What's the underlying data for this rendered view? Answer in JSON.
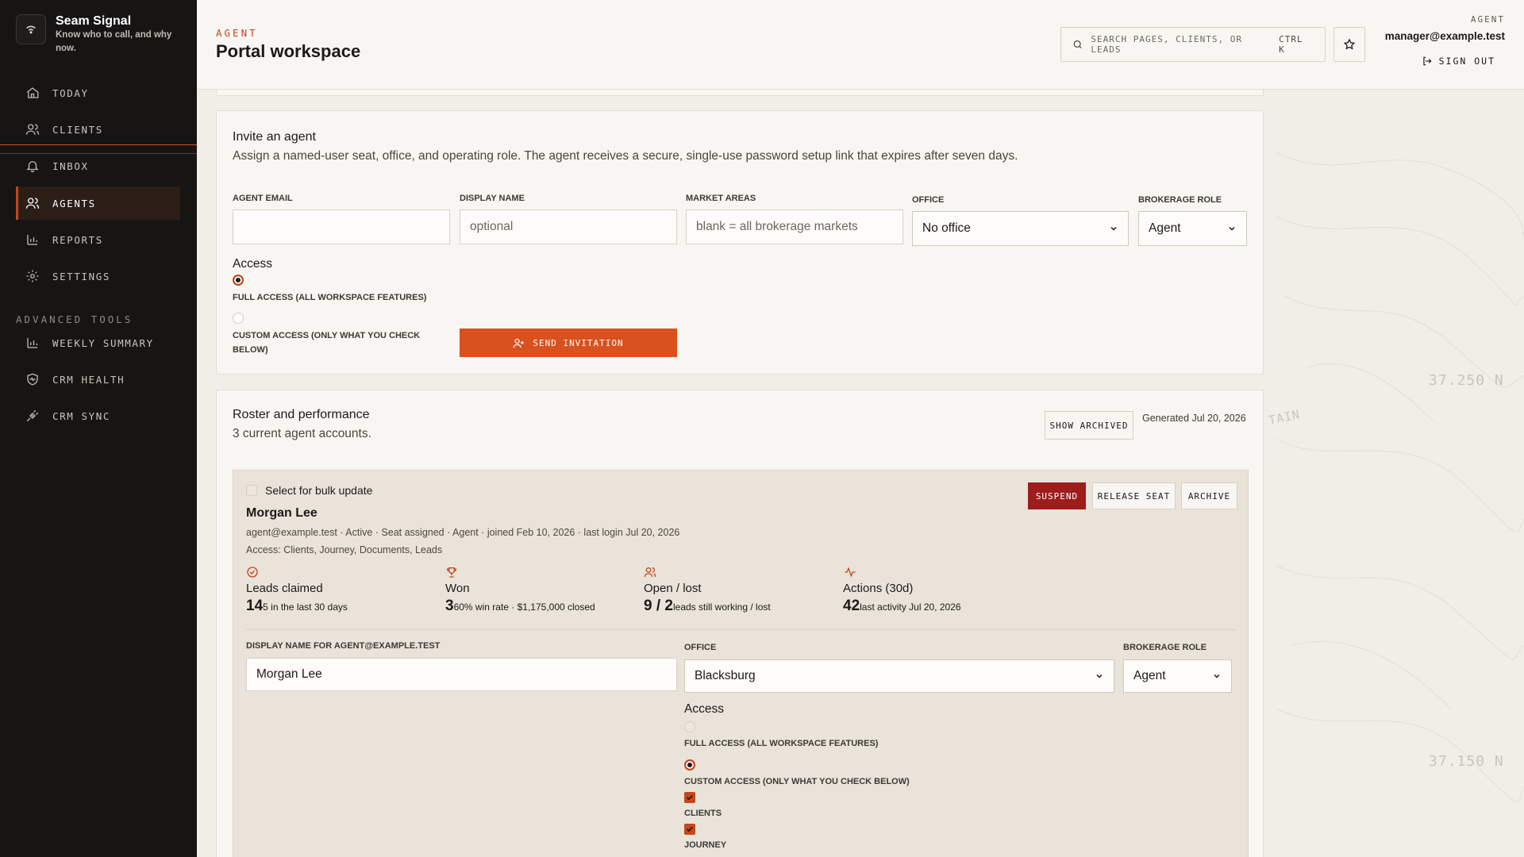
{
  "brand": {
    "name": "Seam Signal",
    "tagline": "Know who to call, and why now."
  },
  "nav": {
    "items": [
      {
        "label": "TODAY"
      },
      {
        "label": "CLIENTS"
      },
      {
        "label": "INBOX"
      },
      {
        "label": "AGENTS"
      },
      {
        "label": "REPORTS"
      },
      {
        "label": "SETTINGS"
      }
    ],
    "advanced_title": "ADVANCED TOOLS",
    "advanced": [
      {
        "label": "WEEKLY SUMMARY"
      },
      {
        "label": "CRM HEALTH"
      },
      {
        "label": "CRM SYNC"
      }
    ]
  },
  "header": {
    "eyebrow": "AGENT",
    "title": "Portal workspace",
    "search_placeholder": "SEARCH PAGES, CLIENTS, OR LEADS",
    "search_shortcut": "CTRL K",
    "role": "AGENT",
    "email": "manager@example.test",
    "signout": "SIGN OUT"
  },
  "background_labels": {
    "lat1": "37.250 N",
    "lat2": "37.150 N",
    "mountain": "TAIN"
  },
  "invite": {
    "title": "Invite an agent",
    "description": "Assign a named-user seat, office, and operating role. The agent receives a secure, single-use password setup link that expires after seven days.",
    "email_label": "AGENT EMAIL",
    "email_value": "",
    "display_label": "DISPLAY NAME",
    "display_placeholder": "optional",
    "market_label": "MARKET AREAS",
    "market_placeholder": "blank = all brokerage markets",
    "office_label": "OFFICE",
    "office_value": "No office",
    "role_label": "BROKERAGE ROLE",
    "role_value": "Agent",
    "access_title": "Access",
    "full_access": "FULL ACCESS (ALL WORKSPACE FEATURES)",
    "custom_access": "CUSTOM ACCESS (ONLY WHAT YOU CHECK BELOW)",
    "send_button": "SEND INVITATION"
  },
  "roster": {
    "title": "Roster and performance",
    "count_text": "3 current agent accounts.",
    "show_archived": "SHOW ARCHIVED",
    "generated": "Generated Jul 20, 2026",
    "agent": {
      "bulk_label": "Select for bulk update",
      "name": "Morgan Lee",
      "meta": "agent@example.test · Active · Seat assigned · Agent · joined Feb 10, 2026 · last login Jul 20, 2026",
      "access_line": "Access: Clients, Journey, Documents, Leads",
      "suspend": "SUSPEND",
      "release": "RELEASE SEAT",
      "archive": "ARCHIVE",
      "stats": [
        {
          "label": "Leads claimed",
          "value": "14",
          "note": "5 in the last 30 days",
          "icon": "check-circle-icon"
        },
        {
          "label": "Won",
          "value": "3",
          "note": "60% win rate · $1,175,000 closed",
          "icon": "trophy-icon"
        },
        {
          "label": "Open / lost",
          "value": "9 / 2",
          "note": "leads still working / lost",
          "icon": "users-icon"
        },
        {
          "label": "Actions (30d)",
          "value": "42",
          "note": "last activity Jul 20, 2026",
          "icon": "activity-icon"
        }
      ],
      "display_label": "DISPLAY NAME FOR AGENT@EXAMPLE.TEST",
      "display_value": "Morgan Lee",
      "office_label": "OFFICE",
      "office_value": "Blacksburg",
      "role_label": "BROKERAGE ROLE",
      "role_value": "Agent",
      "access_title": "Access",
      "full_access": "FULL ACCESS (ALL WORKSPACE FEATURES)",
      "custom_access": "CUSTOM ACCESS (ONLY WHAT YOU CHECK BELOW)",
      "perm_clients": "CLIENTS",
      "perm_journey": "JOURNEY"
    }
  },
  "colors": {
    "accent": "#d9511e",
    "danger": "#9d1c1c",
    "sidebar": "#161514"
  }
}
